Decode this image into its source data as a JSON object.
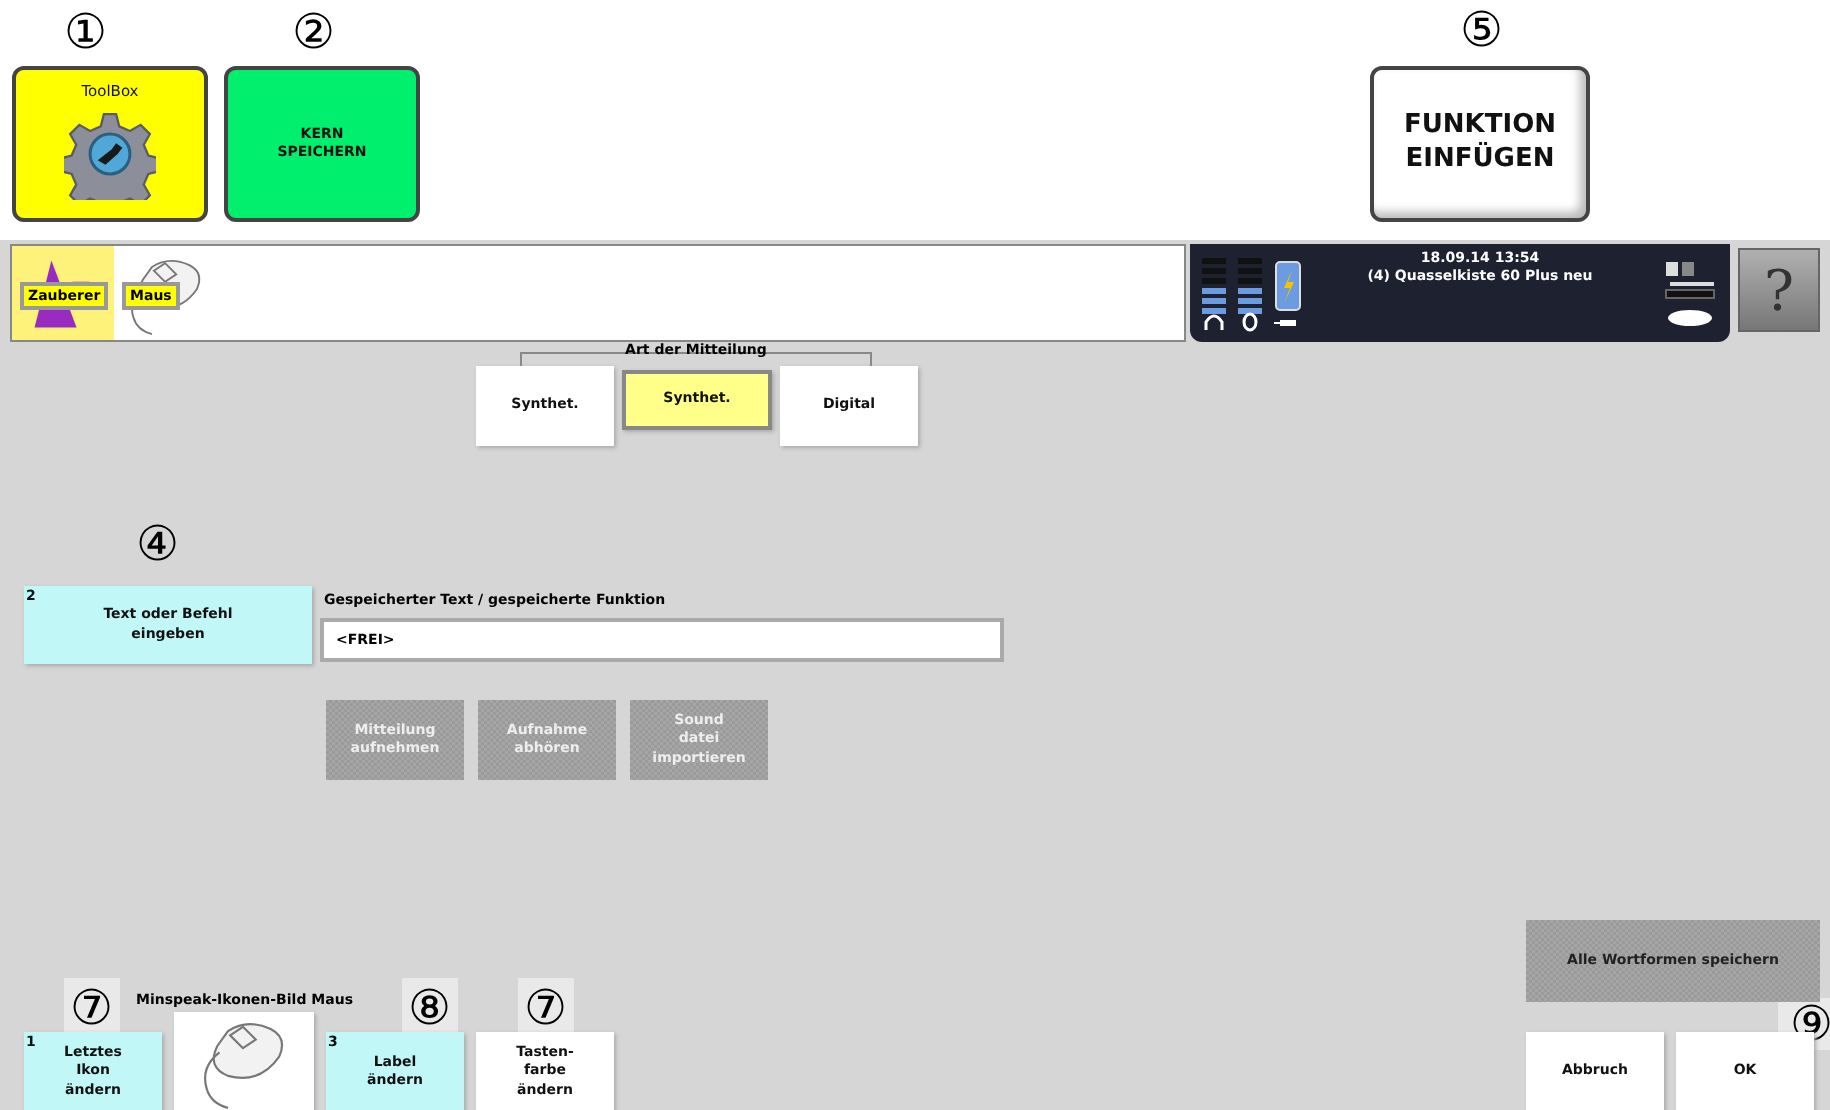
{
  "top_callouts": [
    "①",
    "②",
    "⑤"
  ],
  "callouts": [
    "④",
    "⑦",
    "⑧",
    "⑦",
    "⑨"
  ],
  "top_buttons": [
    {
      "kind": "icon",
      "label": "ToolBox",
      "color": "#ffff00"
    },
    {
      "kind": "text",
      "label": "KERN\nSPEICHERN",
      "color": "#00f06e"
    },
    {
      "kind": "big",
      "label": "FUNKTION\nEINFÜGEN",
      "color": "#ffffff"
    }
  ],
  "header": {
    "icons": [
      {
        "label": "Zauberer",
        "selected": true,
        "kind": "wizard"
      },
      {
        "label": "Maus",
        "selected": false,
        "kind": "mouse"
      }
    ],
    "date": "18.09.14 13:54",
    "device": "(4) Quasselkiste 60 Plus neu",
    "help": "?"
  },
  "message_type": {
    "legend": "Art der Mitteilung",
    "options": [
      {
        "label": "Synthet.",
        "selected": false
      },
      {
        "label": "Synthet.",
        "selected": true
      },
      {
        "label": "Digital",
        "selected": false
      }
    ]
  },
  "text_button": {
    "number": "2",
    "label": "Text oder Befehl\neingeben"
  },
  "stored": {
    "label": "Gespeicherter Text / gespeicherte Funktion",
    "value": "<FREI>"
  },
  "actions": [
    {
      "label": "Mitteilung\naufnehmen",
      "disabled": true
    },
    {
      "label": "Aufnahme\nabhören",
      "disabled": true
    },
    {
      "label": "Sound\ndatei\nimportieren",
      "disabled": true
    }
  ],
  "icon_caption": "Minspeak-Ikonen-Bild Maus",
  "bottom_buttons": [
    {
      "kind": "edit",
      "number": "1",
      "label": "Letztes\nIkon\nändern"
    },
    {
      "kind": "image"
    },
    {
      "kind": "edit",
      "number": "3",
      "label": "Label\nändern"
    },
    {
      "kind": "plain",
      "label": "Tasten-\nfarbe\nändern"
    }
  ],
  "save_all": {
    "label": "Alle Wortformen speichern",
    "disabled": true
  },
  "dialog_buttons": [
    {
      "label": "Abbruch"
    },
    {
      "label": "OK"
    }
  ]
}
